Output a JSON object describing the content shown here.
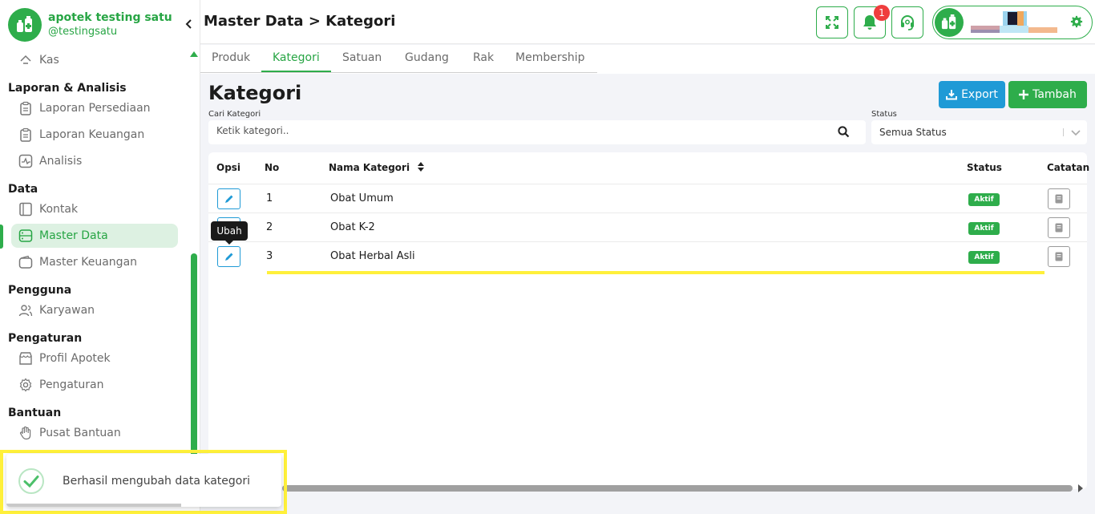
{
  "brand": {
    "name": "apotek testing satu",
    "handle": "@testingsatu"
  },
  "sidebar": {
    "top_item": {
      "label": "Kas"
    },
    "sections": [
      {
        "title": "Laporan & Analisis",
        "items": [
          "Laporan Persediaan",
          "Laporan Keuangan",
          "Analisis"
        ]
      },
      {
        "title": "Data",
        "items": [
          "Kontak",
          "Master Data",
          "Master Keuangan"
        ]
      },
      {
        "title": "Pengguna",
        "items": [
          "Karyawan"
        ]
      },
      {
        "title": "Pengaturan",
        "items": [
          "Profil Apotek",
          "Pengaturan"
        ]
      },
      {
        "title": "Bantuan",
        "items": [
          "Pusat Bantuan"
        ]
      }
    ],
    "active_item": "Master Data"
  },
  "header": {
    "title": "Master Data > Kategori",
    "notification_count": "1"
  },
  "tabs": [
    "Produk",
    "Kategori",
    "Satuan",
    "Gudang",
    "Rak",
    "Membership"
  ],
  "active_tab": "Kategori",
  "content": {
    "title": "Kategori",
    "export_label": "Export",
    "tambah_label": "Tambah",
    "search_label": "Cari Kategori",
    "search_placeholder": "Ketik kategori..",
    "status_label": "Status",
    "status_value": "Semua Status"
  },
  "table": {
    "headers": {
      "opsi": "Opsi",
      "no": "No",
      "nama": "Nama Kategori",
      "status": "Status",
      "catatan": "Catatan"
    },
    "rows": [
      {
        "no": "1",
        "name": "Obat Umum",
        "status": "Aktif"
      },
      {
        "no": "2",
        "name": "Obat K-2",
        "status": "Aktif"
      },
      {
        "no": "3",
        "name": "Obat Herbal Asli",
        "status": "Aktif"
      }
    ]
  },
  "tooltip": {
    "text": "Ubah"
  },
  "toast": {
    "message": "Berhasil mengubah data kategori"
  },
  "colors": {
    "primary": "#2ead4b",
    "info": "#1f9ad6",
    "danger": "#ef3d3d",
    "highlight": "#fff03a"
  }
}
